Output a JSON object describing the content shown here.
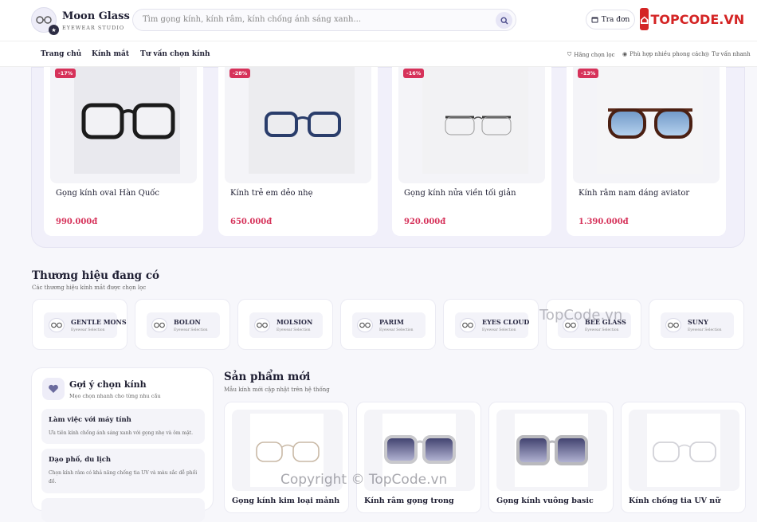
{
  "header": {
    "brand": "Moon Glass",
    "tagline": "EYEWEAR STUDIO",
    "search_placeholder": "Tìm gọng kính, kính râm, kính chống ánh sáng xanh...",
    "order_button": "Tra đơn",
    "watermark_logo": "TOPCODE.VN"
  },
  "nav": {
    "items": [
      "Trang chủ",
      "Kính mắt",
      "Tư vấn chọn kính"
    ],
    "badges": [
      "Hãng chọn lọc",
      "Phù hợp nhiều phong cách",
      "Tư vấn nhanh"
    ]
  },
  "featured": [
    {
      "discount": "-17%",
      "name": "Gọng kính oval Hàn Quốc",
      "price": "990.000đ"
    },
    {
      "discount": "-28%",
      "name": "Kính trẻ em dẻo nhẹ",
      "price": "650.000đ"
    },
    {
      "discount": "-16%",
      "name": "Gọng kính nửa viền tối giản",
      "price": "920.000đ"
    },
    {
      "discount": "-13%",
      "name": "Kính râm nam dáng aviator",
      "price": "1.390.000đ"
    }
  ],
  "brands_section": {
    "title": "Thương hiệu đang có",
    "subtitle": "Các thương hiệu kính mắt được chọn lọc",
    "brand_subtitle": "Eyewear Selection",
    "items": [
      "GENTLE MONS",
      "BOLON",
      "MOLSION",
      "PARIM",
      "EYES CLOUD",
      "BEE GLASS",
      "SUNY"
    ]
  },
  "advice": {
    "title": "Gợi ý chọn kính",
    "subtitle": "Mẹo chọn nhanh cho từng nhu cầu",
    "tips": [
      {
        "title": "Làm việc với máy tính",
        "desc": "Ưu tiên kính chống ánh sáng xanh với gọng nhẹ và ôm mặt."
      },
      {
        "title": "Dạo phố, du lịch",
        "desc": "Chọn kính râm có khả năng chống tia UV và màu sắc dễ phối đồ."
      }
    ]
  },
  "new_products": {
    "title": "Sản phẩm mới",
    "subtitle": "Mẫu kính mới cập nhật trên hệ thống",
    "items": [
      "Gọng kính kim loại mảnh",
      "Kính râm gọng trong",
      "Gọng kính vuông basic",
      "Kính chống tia UV nữ"
    ]
  },
  "watermarks": [
    "TopCode.vn",
    "Copyright © TopCode.vn"
  ],
  "colors": {
    "accent": "#d6325a",
    "primary": "#1f1f33",
    "soft": "#f1f0fa"
  }
}
